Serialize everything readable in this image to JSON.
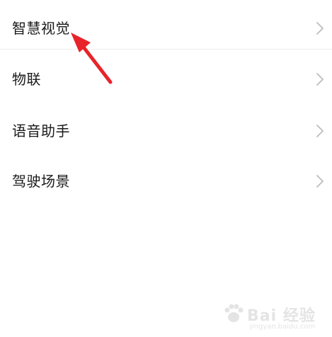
{
  "settings": {
    "items": [
      {
        "label": "智慧视觉"
      },
      {
        "label": "物联"
      },
      {
        "label": "语音助手"
      },
      {
        "label": "驾驶场景"
      }
    ]
  },
  "watermark": {
    "text": "Bai 经验",
    "sub": "jingyan.baidu.com"
  },
  "colors": {
    "arrow": "#e8232a",
    "chevron": "#bdbdbd",
    "text": "#1a1a1a"
  },
  "icons": {
    "chevron": "chevron-right-icon",
    "arrow": "annotation-arrow-icon",
    "watermark": "baidu-paw-icon"
  }
}
